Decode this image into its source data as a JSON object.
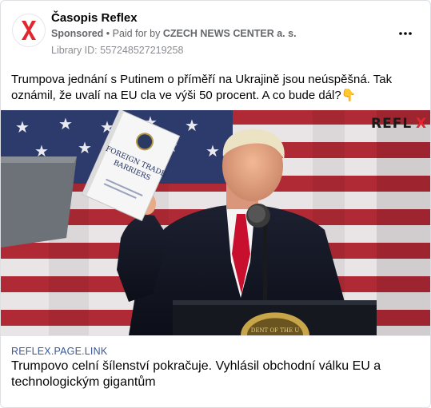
{
  "post": {
    "page_name": "Časopis Reflex",
    "sponsored_label": "Sponsored",
    "paid_prefix": " • Paid for by ",
    "payer": "CZECH NEWS CENTER a. s.",
    "library_id": "Library ID: 557248527219258",
    "more_icon": "three-dots-icon",
    "text": "Trumpova jednání s Putinem o příměří na Ukrajině jsou neúspěšná. Tak oznámil, že uvalí na EU cla ve výši 50 procent. A co bude dál?👇"
  },
  "image": {
    "watermark_left": "REFL",
    "watermark_right": "X",
    "book_title_line1": "FOREIGN TRADE",
    "book_title_line2": "BARRIERS",
    "seal_text": "DENT OF THE U"
  },
  "link": {
    "domain": "REFLEX.PAGE.LINK",
    "title": "Trumpovo celní šílenství pokračuje. Vyhlásil obchodní válku EU a technologickým gigantům"
  },
  "colors": {
    "brand_red": "#e3262d",
    "link_blue": "#385898",
    "meta_gray": "#65676b"
  }
}
